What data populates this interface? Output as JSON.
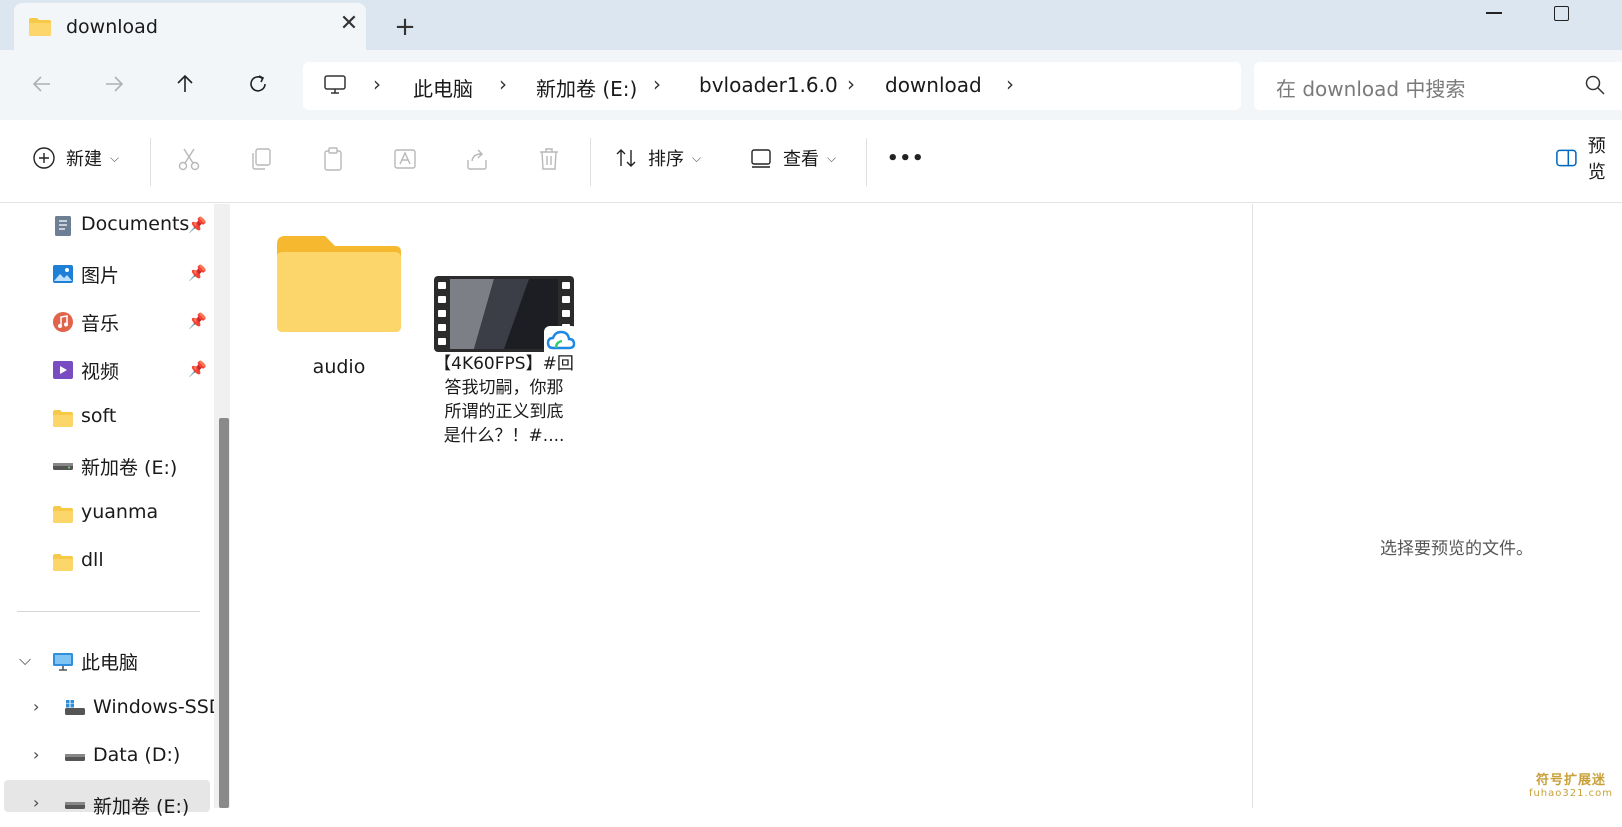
{
  "window": {
    "tab_title": "download",
    "tab_close": "✕",
    "new_tab": "+"
  },
  "nav": {
    "back": "←",
    "forward": "→",
    "up": "↑",
    "refresh": "↻"
  },
  "breadcrumb": [
    "此电脑",
    "新加卷 (E:)",
    "bvloader1.6.0",
    "download"
  ],
  "search": {
    "placeholder": "在 download 中搜索"
  },
  "toolbar": {
    "new_label": "新建",
    "sort_label": "排序",
    "view_label": "查看",
    "more_label": "•••",
    "preview_label": "预览"
  },
  "sidebar": {
    "quick_access": [
      {
        "label": "Documents",
        "icon": "document-icon",
        "pinned": true
      },
      {
        "label": "图片",
        "icon": "pictures-icon",
        "pinned": true
      },
      {
        "label": "音乐",
        "icon": "music-icon",
        "pinned": true
      },
      {
        "label": "视频",
        "icon": "video-icon",
        "pinned": true
      },
      {
        "label": "soft",
        "icon": "folder-icon",
        "pinned": false
      },
      {
        "label": "新加卷 (E:)",
        "icon": "drive-icon",
        "pinned": false
      },
      {
        "label": "yuanma",
        "icon": "folder-icon",
        "pinned": false
      },
      {
        "label": "dll",
        "icon": "folder-icon",
        "pinned": false
      }
    ],
    "this_pc": "此电脑",
    "drives": [
      "Windows-SSD",
      "Data (D:)",
      "新加卷 (E:)"
    ]
  },
  "files": [
    {
      "name": "audio",
      "type": "folder"
    },
    {
      "name_lines": [
        "【4K60FPS】#回",
        "答我切嗣，你那",
        "所谓的正义到底",
        "是什么？！#...."
      ],
      "type": "video"
    }
  ],
  "preview": {
    "empty_text": "选择要预览的文件。"
  },
  "watermark": {
    "line1": "符号扩展迷",
    "line2": "fuhao321.com"
  },
  "colors": {
    "titlebar": "#dce6f0",
    "folder": "#f7c948",
    "accent": "#0067c0"
  }
}
